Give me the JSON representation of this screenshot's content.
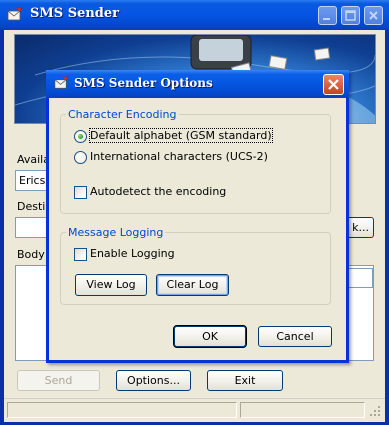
{
  "main_window": {
    "title": "SMS Sender",
    "labels": {
      "available": "Availa",
      "device_value": "Ericss",
      "destination": "Destin",
      "body": "Body o",
      "browse_partial": "k..."
    },
    "buttons": {
      "send": "Send",
      "options": "Options...",
      "exit": "Exit"
    }
  },
  "dialog": {
    "title": "SMS Sender Options",
    "encoding_group": {
      "title": "Character Encoding",
      "option_default": "Default alphabet (GSM standard)",
      "option_international": "International characters (UCS-2)",
      "selected": "Default alphabet (GSM standard)",
      "autodetect_label": "Autodetect the encoding",
      "autodetect_checked": false
    },
    "logging_group": {
      "title": "Message Logging",
      "enable_label": "Enable Logging",
      "enable_checked": false,
      "view_log": "View Log",
      "clear_log": "Clear Log"
    },
    "ok": "OK",
    "cancel": "Cancel"
  },
  "colors": {
    "title_blue": "#0554e3",
    "face": "#ece9d8",
    "group_title": "#0046d5",
    "close_red": "#c9421f"
  }
}
